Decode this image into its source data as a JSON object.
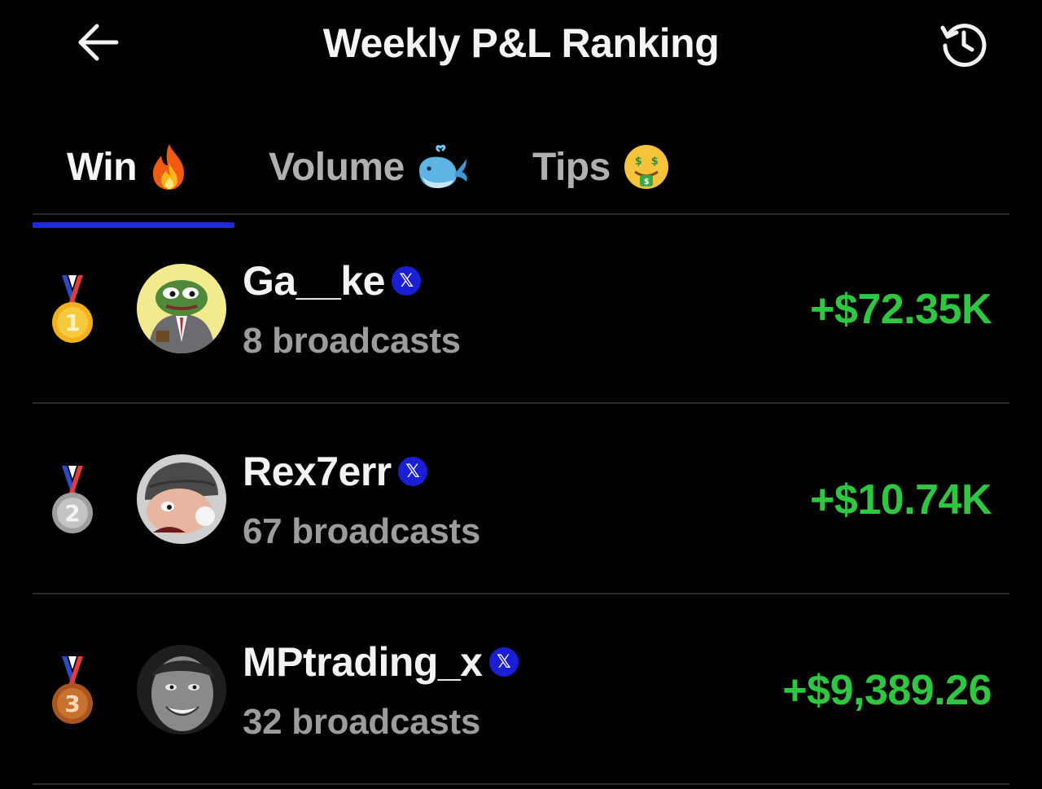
{
  "header": {
    "title": "Weekly P&L Ranking",
    "back_icon": "arrow-left-icon",
    "history_icon": "history-clock-icon"
  },
  "tabs": [
    {
      "label": "Win",
      "emoji": "🔥",
      "active": true
    },
    {
      "label": "Volume",
      "emoji": "🐳",
      "active": false
    },
    {
      "label": "Tips",
      "emoji": "🤑",
      "active": false
    }
  ],
  "colors": {
    "background": "#000000",
    "accent": "#1c27e8",
    "gain": "#2ec840",
    "secondary_text": "#9c9c9c"
  },
  "ranking": [
    {
      "rank": "1",
      "medal": "gold",
      "name": "Ga__ke",
      "verified_badge": "𝕏",
      "broadcasts": "8 broadcasts",
      "pnl": "+$72.35K"
    },
    {
      "rank": "2",
      "medal": "silver",
      "name": "Rex7err",
      "verified_badge": "𝕏",
      "broadcasts": "67 broadcasts",
      "pnl": "+$10.74K"
    },
    {
      "rank": "3",
      "medal": "bronze",
      "name": "MPtrading_x",
      "verified_badge": "𝕏",
      "broadcasts": "32 broadcasts",
      "pnl": "+$9,389.26"
    }
  ]
}
